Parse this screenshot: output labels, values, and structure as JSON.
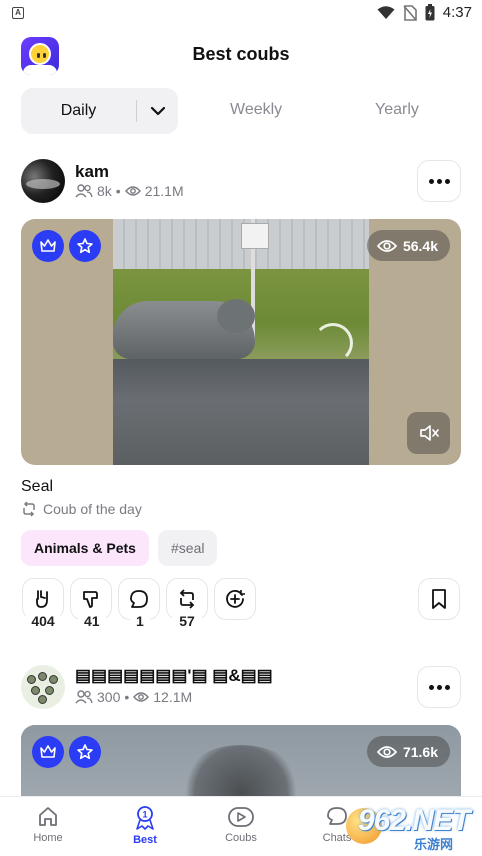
{
  "status_bar": {
    "time": "4:37",
    "notification_glyph": "A"
  },
  "header": {
    "title": "Best coubs"
  },
  "tabs": {
    "daily": "Daily",
    "weekly": "Weekly",
    "yearly": "Yearly"
  },
  "posts": [
    {
      "username": "kam",
      "followers": "8k",
      "views_total": "21.1M",
      "video_views": "56.4k",
      "title": "Seal",
      "subtitle": "Coub of the day",
      "category": "Animals & Pets",
      "tag": "#seal",
      "actions": {
        "likes": "404",
        "dislikes": "41",
        "comments": "1",
        "recoubs": "57"
      }
    },
    {
      "username": "▤▤▤▤▤▤▤'▤ ▤&▤▤",
      "followers": "300",
      "views_total": "12.1M",
      "video_views": "71.6k"
    }
  ],
  "bottom_nav": {
    "home": "Home",
    "best": "Best",
    "coubs": "Coubs",
    "chats": "Chats"
  },
  "watermark": {
    "text": "962.NET",
    "sub": "乐游网"
  },
  "colors": {
    "accent": "#2b3cf5",
    "category_chip": "#fbe6fb"
  }
}
